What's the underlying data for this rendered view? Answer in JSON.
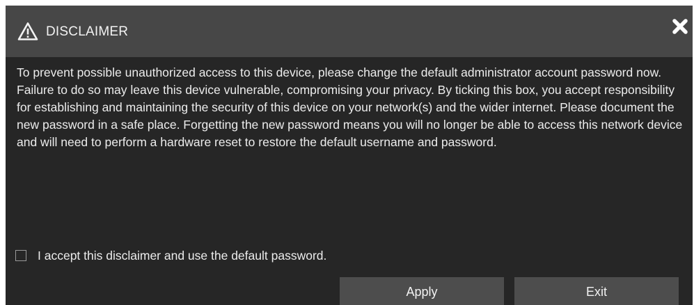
{
  "dialog": {
    "title": "DISCLAIMER",
    "title_icon": "warning-triangle-icon",
    "close_icon": "close-x-icon",
    "message": "To prevent possible unauthorized access to this device, please change the default administrator account password now. Failure to do so may leave this device vulnerable, compromising your privacy. By ticking this box, you accept responsibility for establishing and maintaining the security of this device on your network(s) and the wider internet. Please document the new password in a safe place. Forgetting the new password means you will no longer be able to access this network device and will need to perform a hardware reset to restore the default username and password.",
    "checkbox": {
      "label": "I accept this disclaimer and use the default password.",
      "checked": false
    },
    "buttons": {
      "apply": "Apply",
      "exit": "Exit"
    }
  },
  "colors": {
    "body_background": "#262626",
    "titlebar_background": "#474747",
    "button_background": "#4d4d4d",
    "text": "#ececec"
  }
}
